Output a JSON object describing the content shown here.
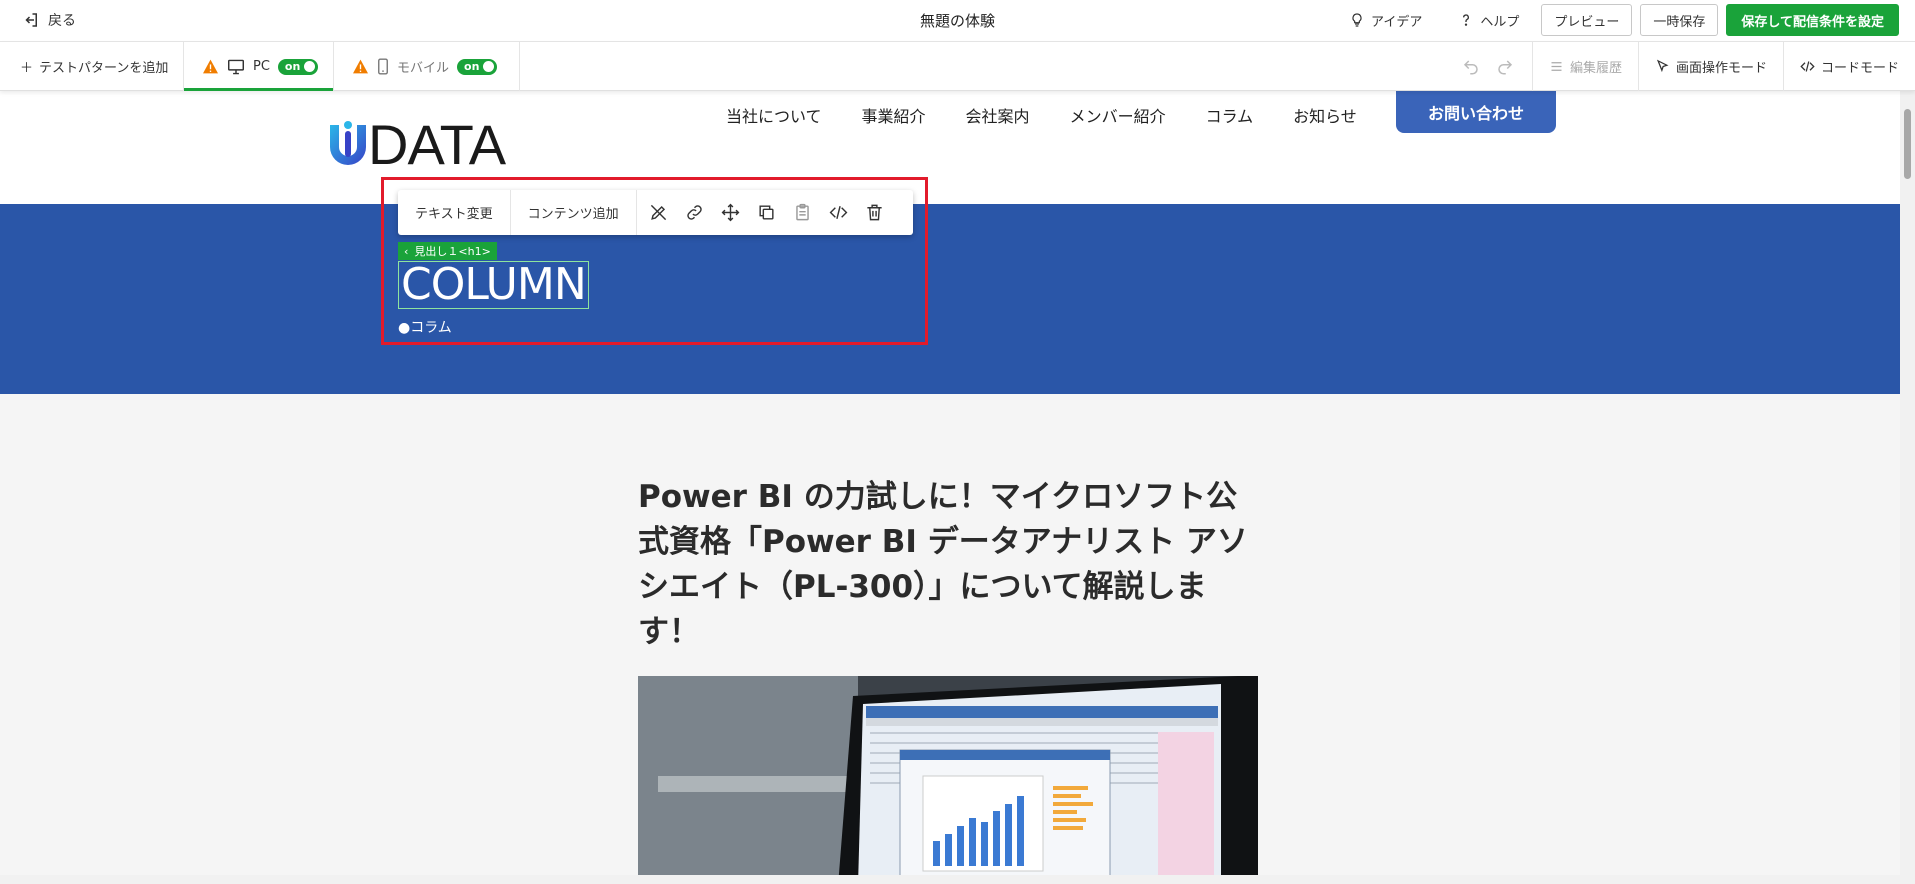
{
  "topbar": {
    "back_label": "戻る",
    "title": "無題の体験",
    "idea_label": "アイデア",
    "help_label": "ヘルプ",
    "preview_label": "プレビュー",
    "save_draft_label": "一時保存",
    "save_publish_label": "保存して配信条件を設定"
  },
  "subbar": {
    "add_pattern_label": "テストパターンを追加",
    "pc_label": "PC",
    "pc_toggle": "on",
    "mobile_label": "モバイル",
    "mobile_toggle": "on",
    "history_label": "編集履歴",
    "screen_mode_label": "画面操作モード",
    "code_mode_label": "コードモード"
  },
  "site": {
    "logo_text": "DATA",
    "nav": [
      "当社について",
      "事業紹介",
      "会社案内",
      "メンバー紹介",
      "コラム",
      "お知らせ"
    ],
    "cta": "お問い合わせ"
  },
  "hero": {
    "toolbar_text_change": "テキスト変更",
    "toolbar_add_content": "コンテンツ追加",
    "element_tag": "見出し１<h1>",
    "heading": "COLUMN",
    "subheading": "●コラム"
  },
  "article": {
    "title": "Power BI の力試しに！マイクロソフト公式資格「Power BI データアナリスト アソシエイト（PL-300）」について解説します！"
  },
  "colors": {
    "accent_green": "#1aa33a",
    "selection_red": "#e21b2b",
    "hero_blue": "#2a56a8",
    "cta_blue": "#3a64b9"
  }
}
